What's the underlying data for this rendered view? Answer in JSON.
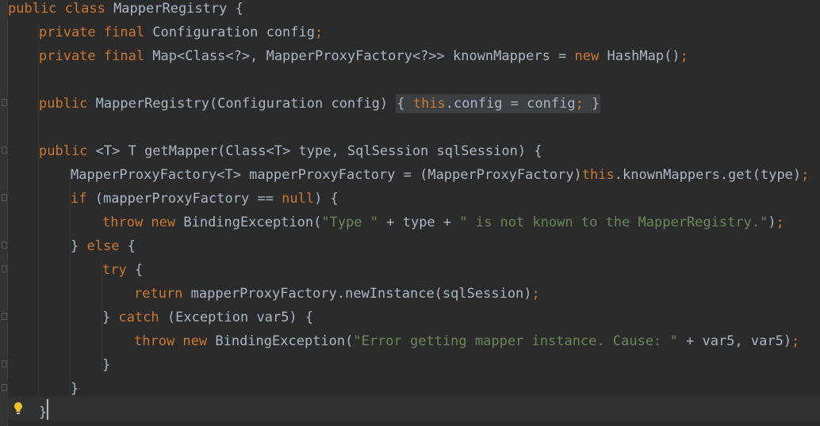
{
  "editor": {
    "lines": [
      [
        [
          "kw",
          "public class "
        ],
        [
          "p",
          "MapperRegistry {"
        ]
      ],
      [
        [
          "kw",
          "private final "
        ],
        [
          "p",
          "Configuration config"
        ],
        [
          "kw",
          ";"
        ]
      ],
      [
        [
          "kw",
          "private final "
        ],
        [
          "p",
          "Map<Class<?>, MapperProxyFactory<?>> knownMappers = "
        ],
        [
          "kw",
          "new "
        ],
        [
          "p",
          "HashMap()"
        ],
        [
          "kw",
          ";"
        ]
      ],
      [],
      [
        [
          "kw",
          "public "
        ],
        [
          "p",
          "MapperRegistry(Configuration config) "
        ],
        [
          "fold",
          "{ "
        ],
        [
          "fk",
          "this"
        ],
        [
          "fp",
          ".config = config"
        ],
        [
          "fk",
          ";"
        ],
        [
          "fold",
          " }"
        ]
      ],
      [],
      [
        [
          "kw",
          "public "
        ],
        [
          "p",
          "<T> T getMapper(Class<T> type, SqlSession sqlSession) {"
        ]
      ],
      [
        [
          "p",
          "MapperProxyFactory<T> mapperProxyFactory = (MapperProxyFactory)"
        ],
        [
          "kw",
          "this"
        ],
        [
          "p",
          ".knownMappers.get(type)"
        ],
        [
          "kw",
          ";"
        ]
      ],
      [
        [
          "kw",
          "if "
        ],
        [
          "p",
          "(mapperProxyFactory == "
        ],
        [
          "kw",
          "null"
        ],
        [
          "p",
          ") {"
        ]
      ],
      [
        [
          "kw",
          "throw new "
        ],
        [
          "p",
          "BindingException("
        ],
        [
          "str",
          "\"Type \""
        ],
        [
          "p",
          " + type + "
        ],
        [
          "str",
          "\" is not known to the MapperRegistry.\""
        ],
        [
          "p",
          ")"
        ],
        [
          "kw",
          ";"
        ]
      ],
      [
        [
          "p",
          "} "
        ],
        [
          "kw",
          "else "
        ],
        [
          "p",
          "{"
        ]
      ],
      [
        [
          "kw",
          "try "
        ],
        [
          "p",
          "{"
        ]
      ],
      [
        [
          "kw",
          "return "
        ],
        [
          "p",
          "mapperProxyFactory.newInstance(sqlSession)"
        ],
        [
          "kw",
          ";"
        ]
      ],
      [
        [
          "p",
          "} "
        ],
        [
          "kw",
          "catch "
        ],
        [
          "p",
          "(Exception var5) {"
        ]
      ],
      [
        [
          "kw",
          "throw new "
        ],
        [
          "p",
          "BindingException("
        ],
        [
          "str",
          "\"Error getting mapper instance. Cause: \""
        ],
        [
          "p",
          " + var5, var5)"
        ],
        [
          "kw",
          ";"
        ]
      ],
      [
        [
          "p",
          "}"
        ]
      ],
      [
        [
          "p",
          "}"
        ]
      ],
      [
        [
          "p",
          "}"
        ]
      ]
    ]
  }
}
